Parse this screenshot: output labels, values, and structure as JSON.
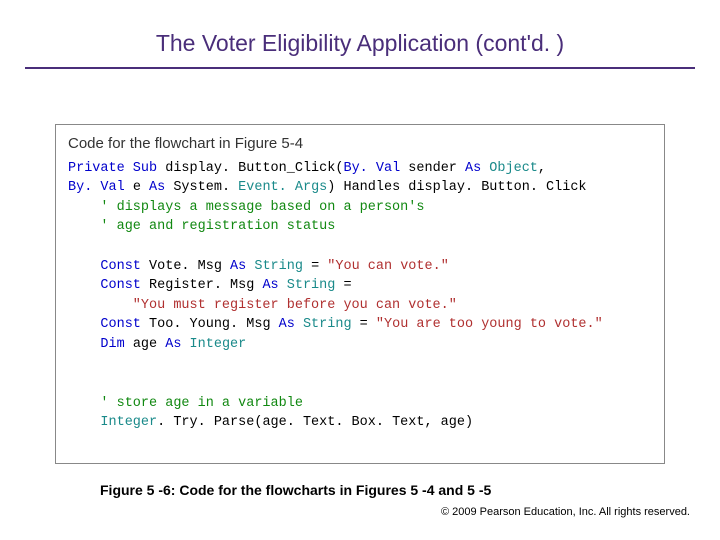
{
  "title": "The Voter Eligibility Application (cont'd. )",
  "figure_title": "Code for the flowchart in Figure 5-4",
  "code": {
    "l1a": "Private Sub",
    "l1b": " display. Button_Click(",
    "l1c": "By. Val",
    "l1d": " sender ",
    "l1e": "As",
    "l1f": " Object",
    "l1g": ",",
    "l2a": "By. Val",
    "l2b": " e ",
    "l2c": "As",
    "l2d": " System. ",
    "l2e": "Event. Args",
    "l2f": ") Handles display. Button. Click",
    "l3": "    ' displays a message based on a person's",
    "l4": "    ' age and registration status",
    "blank1": " ",
    "l5a": "    Const",
    "l5b": " Vote. Msg ",
    "l5c": "As",
    "l5d": " String",
    "l5e": " = ",
    "l5f": "\"You can vote.\"",
    "l6a": "    Const",
    "l6b": " Register. Msg ",
    "l6c": "As",
    "l6d": " String",
    "l6e": " =",
    "l7": "        \"You must register before you can vote.\"",
    "l8a": "    Const",
    "l8b": " Too. Young. Msg ",
    "l8c": "As",
    "l8d": " String",
    "l8e": " = ",
    "l8f": "\"You are too young to vote.\"",
    "l9a": "    Dim",
    "l9b": " age ",
    "l9c": "As",
    "l9d": " Integer",
    "blank2": " ",
    "blank3": " ",
    "l10": "    ' store age in a variable",
    "l11a": "    Integer",
    "l11b": ". Try. Parse(age. Text. Box. Text, age)"
  },
  "caption": "Figure 5 -6: Code for the flowcharts in Figures 5 -4 and 5 -5",
  "footer_copyright": "© 2009 Pearson Education, Inc.  All rights reserved."
}
